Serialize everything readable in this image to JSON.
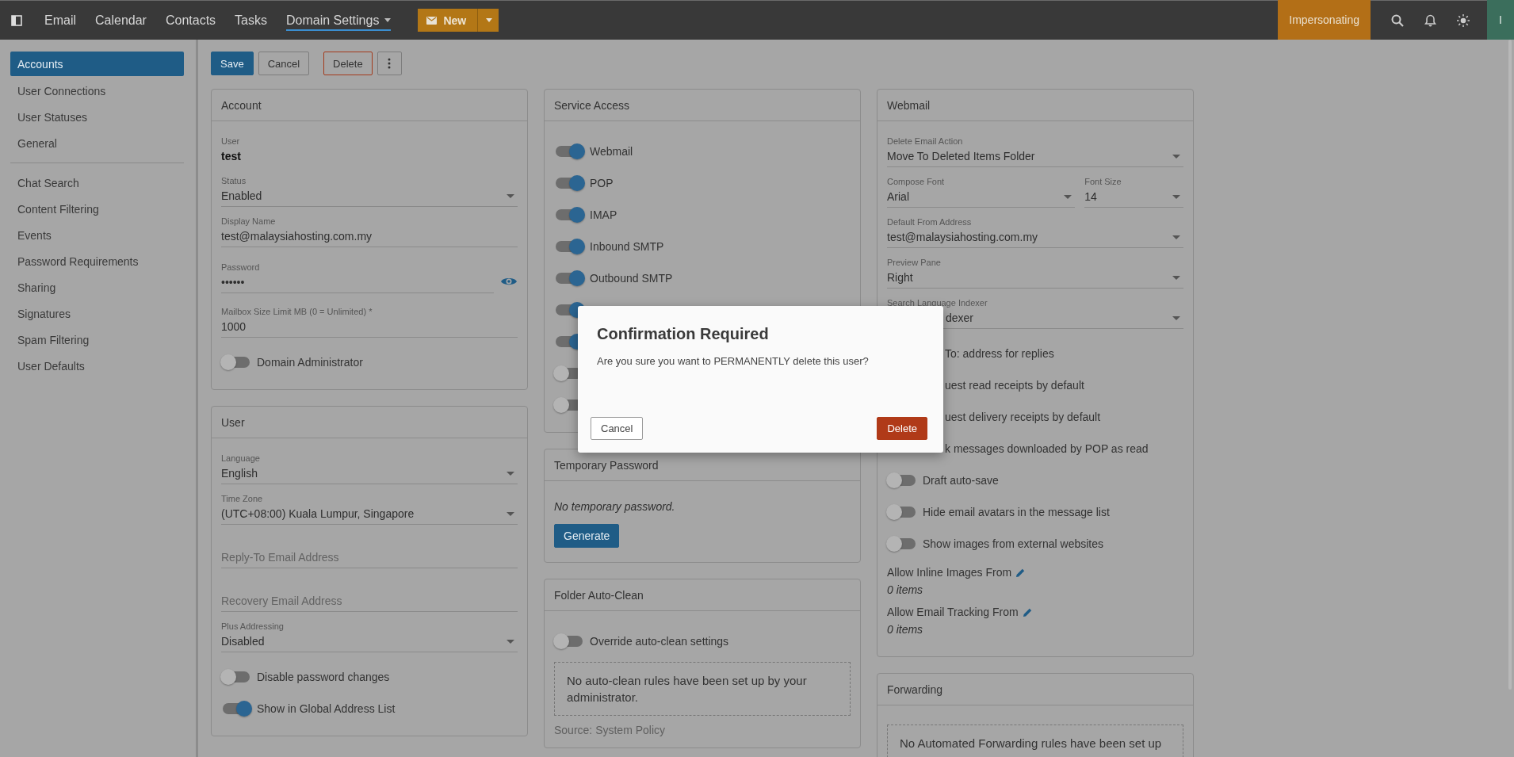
{
  "top_nav": {
    "items": [
      {
        "label": "Email",
        "selected": false,
        "has_menu": false
      },
      {
        "label": "Calendar",
        "selected": false,
        "has_menu": false
      },
      {
        "label": "Contacts",
        "selected": false,
        "has_menu": false
      },
      {
        "label": "Tasks",
        "selected": false,
        "has_menu": false
      },
      {
        "label": "Domain Settings",
        "selected": true,
        "has_menu": true
      }
    ],
    "new_button": "New",
    "impersonating": "Impersonating",
    "avatar": "I"
  },
  "sidebar": {
    "groups": [
      [
        {
          "label": "Accounts",
          "selected": true
        },
        {
          "label": "User Connections",
          "selected": false
        },
        {
          "label": "User Statuses",
          "selected": false
        },
        {
          "label": "General",
          "selected": false
        }
      ],
      [
        {
          "label": "Chat Search",
          "selected": false
        },
        {
          "label": "Content Filtering",
          "selected": false
        },
        {
          "label": "Events",
          "selected": false
        },
        {
          "label": "Password Requirements",
          "selected": false
        },
        {
          "label": "Sharing",
          "selected": false
        },
        {
          "label": "Signatures",
          "selected": false
        },
        {
          "label": "Spam Filtering",
          "selected": false
        },
        {
          "label": "User Defaults",
          "selected": false
        }
      ]
    ]
  },
  "toolbar": {
    "save": "Save",
    "cancel": "Cancel",
    "delete": "Delete"
  },
  "columns": [
    [
      {
        "title": "Account",
        "rows": [
          {
            "kind": "static",
            "label": "User",
            "value": "test"
          },
          {
            "kind": "select",
            "label": "Status",
            "value": "Enabled"
          },
          {
            "kind": "text",
            "label": "Display Name",
            "value": "test@malaysiahosting.com.my"
          },
          {
            "kind": "password",
            "label": "Password",
            "value": "••••••"
          },
          {
            "kind": "text",
            "label": "Mailbox Size Limit MB (0 = Unlimited) *",
            "value": "1000"
          },
          {
            "kind": "toggle",
            "label": "Domain Administrator",
            "on": false
          }
        ]
      },
      {
        "title": "User",
        "rows": [
          {
            "kind": "select",
            "label": "Language",
            "value": "English"
          },
          {
            "kind": "select",
            "label": "Time Zone",
            "value": "(UTC+08:00) Kuala Lumpur, Singapore"
          },
          {
            "kind": "placeholder",
            "placeholder": "Reply-To Email Address"
          },
          {
            "kind": "placeholder",
            "placeholder": "Recovery Email Address"
          },
          {
            "kind": "select",
            "label": "Plus Addressing",
            "value": "Disabled"
          },
          {
            "kind": "toggle",
            "label": "Disable password changes",
            "on": false
          },
          {
            "kind": "toggle",
            "label": "Show in Global Address List",
            "on": true
          }
        ]
      }
    ],
    [
      {
        "title": "Service Access",
        "rows": [
          {
            "kind": "toggle",
            "label": "Webmail",
            "on": true
          },
          {
            "kind": "toggle",
            "label": "POP",
            "on": true
          },
          {
            "kind": "toggle",
            "label": "IMAP",
            "on": true
          },
          {
            "kind": "toggle",
            "label": "Inbound SMTP",
            "on": true
          },
          {
            "kind": "toggle",
            "label": "Outbound SMTP",
            "on": true
          },
          {
            "kind": "toggle",
            "on": true
          },
          {
            "kind": "toggle",
            "on": true
          },
          {
            "kind": "toggle",
            "on": false
          },
          {
            "kind": "toggle",
            "on": false
          }
        ]
      },
      {
        "title": "Temporary Password",
        "rows": [
          {
            "kind": "note",
            "text": "No temporary password."
          },
          {
            "kind": "button",
            "label": "Generate"
          }
        ]
      },
      {
        "title": "Folder Auto-Clean",
        "rows": [
          {
            "kind": "toggle",
            "label": "Override auto-clean settings",
            "on": false
          },
          {
            "kind": "dashed",
            "text": "No auto-clean rules have been set up by your administrator."
          },
          {
            "kind": "source",
            "text": "Source: System Policy"
          }
        ]
      }
    ],
    [
      {
        "title": "Webmail",
        "rows": [
          {
            "kind": "select",
            "label": "Delete Email Action",
            "value": "Move To Deleted Items Folder"
          },
          {
            "kind": "pair",
            "items": [
              {
                "label": "Compose Font",
                "value": "Arial"
              },
              {
                "label": "Font Size",
                "value": "14"
              }
            ]
          },
          {
            "kind": "select",
            "label": "Default From Address",
            "value": "test@malaysiahosting.com.my"
          },
          {
            "kind": "select",
            "label": "Preview Pane",
            "value": "Right"
          },
          {
            "kind": "covered_select",
            "label": "Search Language Indexer",
            "value": "dexer"
          },
          {
            "kind": "covered_toggle",
            "label": "To: address for replies"
          },
          {
            "kind": "covered_toggle",
            "label": "uest read receipts by default"
          },
          {
            "kind": "covered_toggle",
            "label": "uest delivery receipts by default"
          },
          {
            "kind": "covered_toggle",
            "label": "k messages downloaded by POP as read"
          },
          {
            "kind": "toggle",
            "label": "Draft auto-save",
            "on": false
          },
          {
            "kind": "toggle",
            "label": "Hide email avatars in the message list",
            "on": false
          },
          {
            "kind": "toggle",
            "label": "Show images from external websites",
            "on": false
          },
          {
            "kind": "list",
            "label": "Allow Inline Images From",
            "value": "0 items"
          },
          {
            "kind": "list",
            "label": "Allow Email Tracking From",
            "value": "0 items"
          }
        ]
      },
      {
        "title": "Forwarding",
        "rows": [
          {
            "kind": "dashed",
            "text": "No Automated Forwarding rules have been set up"
          }
        ]
      }
    ]
  ],
  "dialog": {
    "title": "Confirmation Required",
    "message": "Are you sure you want to PERMANENTLY delete this user?",
    "cancel": "Cancel",
    "confirm": "Delete"
  }
}
